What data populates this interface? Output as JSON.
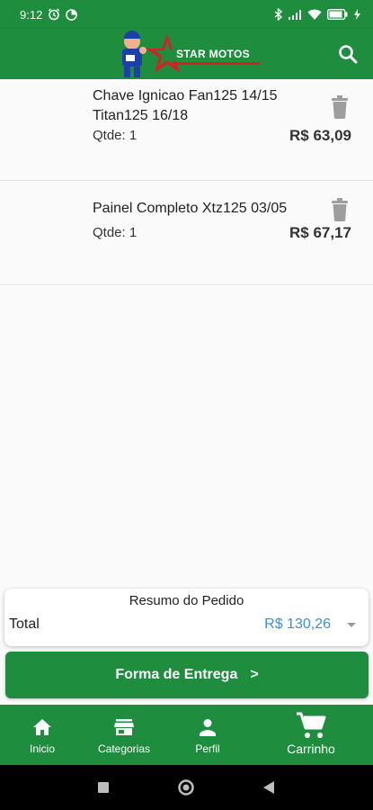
{
  "status_bar": {
    "time": "9:12",
    "battery": "80"
  },
  "app_bar": {
    "logo_text": "STAR MOTOS"
  },
  "cart_items": [
    {
      "name": "Chave Ignicao Fan125 14/15 Titan125 16/18",
      "qty": "Qtde: 1",
      "price": "R$ 63,09"
    },
    {
      "name": "Painel Completo Xtz125 03/05",
      "qty": "Qtde: 1",
      "price": "R$ 67,17"
    }
  ],
  "summary": {
    "title": "Resumo do Pedido",
    "total_label": "Total",
    "total_value": "R$ 130,26"
  },
  "delivery_button": {
    "label": "Forma de Entrega",
    "chevron": ">"
  },
  "bottom_nav": [
    {
      "label": "Inicio",
      "icon": "home-icon"
    },
    {
      "label": "Categorias",
      "icon": "store-icon"
    },
    {
      "label": "Perfil",
      "icon": "person-icon"
    },
    {
      "label": "Carrinho",
      "icon": "cart-icon"
    }
  ],
  "colors": {
    "primary": "#1e8e3e",
    "price_accent": "#3d8fd8",
    "trash": "#9e9e9e"
  }
}
